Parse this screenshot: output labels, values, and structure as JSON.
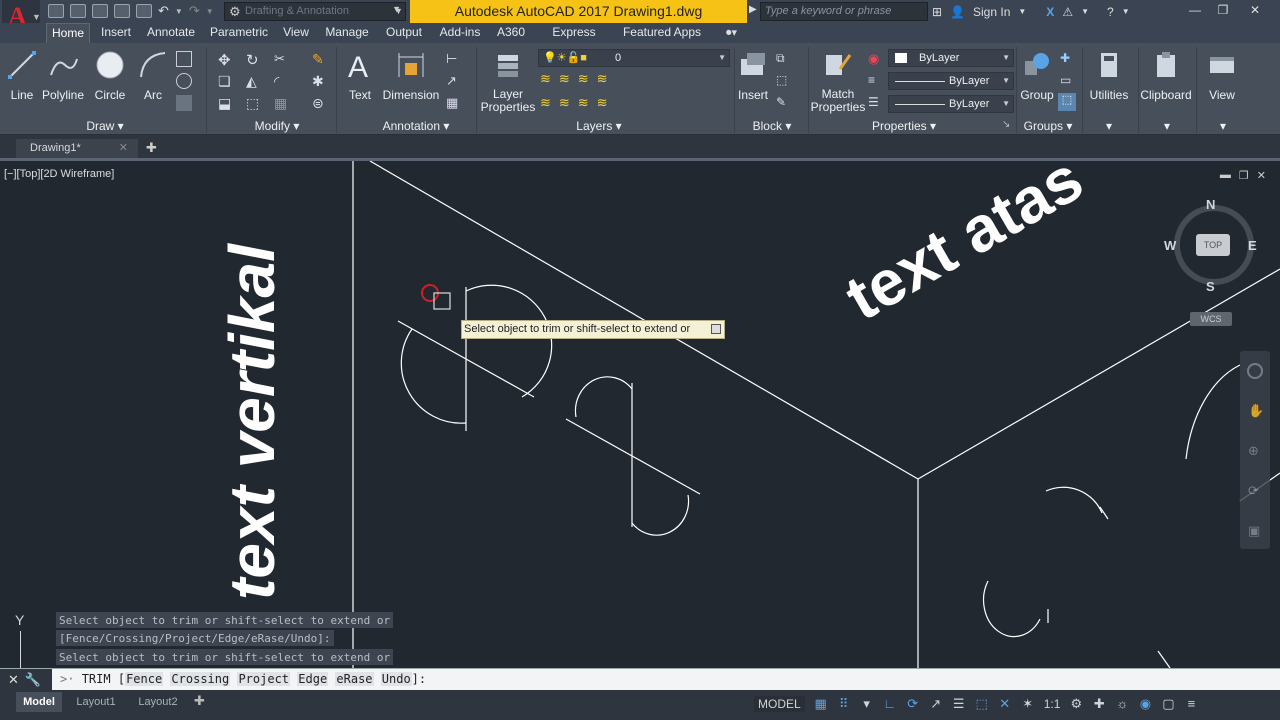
{
  "titlebar": {
    "workspace": "Drafting & Annotation",
    "title": "Autodesk AutoCAD 2017    Drawing1.dwg",
    "search_placeholder": "Type a keyword or phrase",
    "sign_in": "Sign In"
  },
  "ribbon": {
    "tabs": [
      "Home",
      "Insert",
      "Annotate",
      "Parametric",
      "View",
      "Manage",
      "Output",
      "Add-ins",
      "A360",
      "Express Tools",
      "Featured Apps"
    ],
    "draw": {
      "line": "Line",
      "polyline": "Polyline",
      "circle": "Circle",
      "arc": "Arc",
      "panel": "Draw"
    },
    "modify": {
      "panel": "Modify"
    },
    "annotation": {
      "text": "Text",
      "dimension": "Dimension",
      "panel": "Annotation"
    },
    "layers": {
      "layer_properties": "Layer Properties",
      "current_layer": "0",
      "panel": "Layers"
    },
    "block": {
      "insert": "Insert",
      "panel": "Block"
    },
    "properties": {
      "match": "Match Properties",
      "color": "ByLayer",
      "linetype": "ByLayer",
      "lineweight": "ByLayer",
      "panel": "Properties"
    },
    "groups": {
      "group": "Group",
      "panel": "Groups"
    },
    "utilities": "Utilities",
    "clipboard": "Clipboard",
    "view": "View"
  },
  "filetab": {
    "name": "Drawing1*"
  },
  "viewport": {
    "label": "[−][Top][2D Wireframe]",
    "text_vertical": "text vertikal",
    "text_top": "text atas",
    "viewcube": {
      "n": "N",
      "s": "S",
      "e": "E",
      "w": "W",
      "top": "TOP",
      "wcs": "WCS"
    },
    "ucs_y": "Y"
  },
  "tooltip": "Select object to trim or shift-select to extend or",
  "command_history": [
    "Select object to trim or shift-select to extend or",
    "[Fence/Crossing/Project/Edge/eRase/Undo]:",
    "Select object to trim or shift-select to extend or"
  ],
  "command_line": {
    "command": "TRIM",
    "options": [
      "Fence",
      "Crossing",
      "Project",
      "Edge",
      "eRase",
      "Undo"
    ],
    "suffix": "]:"
  },
  "statusbar": {
    "tabs": [
      "Model",
      "Layout1",
      "Layout2"
    ],
    "model_button": "MODEL",
    "scale": "1:1"
  },
  "colors": {
    "background": "#212830",
    "ribbon": "#474f5b",
    "title_accent": "#f6c216",
    "geometry": "#ffffff"
  }
}
